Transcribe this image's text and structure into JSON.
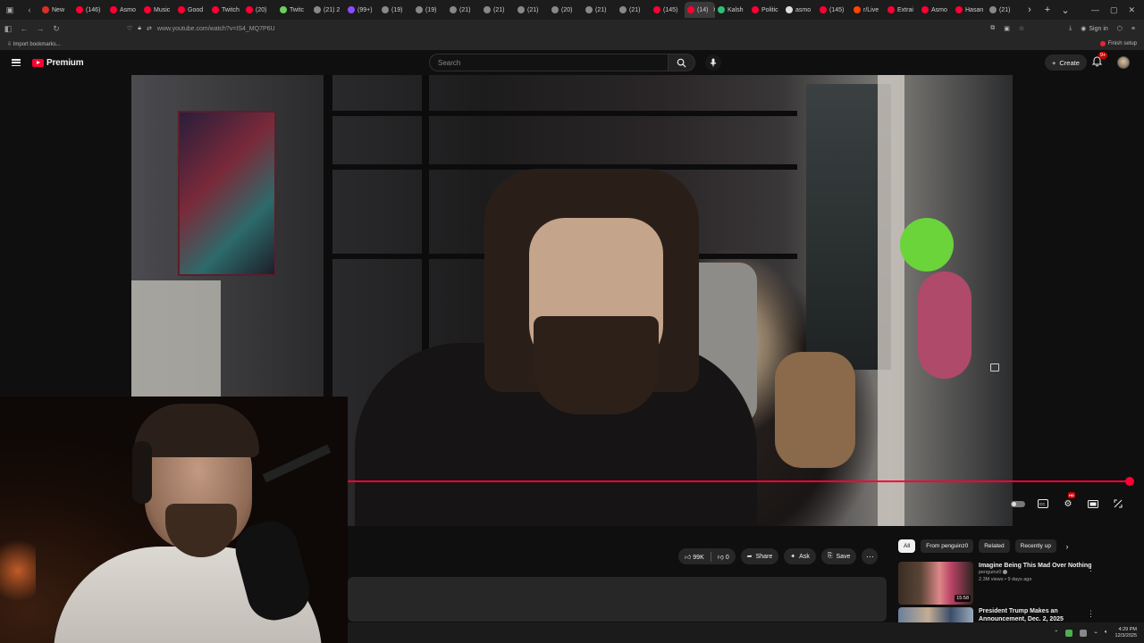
{
  "browser": {
    "tabs": [
      {
        "label": "New",
        "color": "#d93025"
      },
      {
        "label": "(146)",
        "color": "#ff0033"
      },
      {
        "label": "Asmo",
        "color": "#ff0033"
      },
      {
        "label": "Music",
        "color": "#ff0033"
      },
      {
        "label": "Good",
        "color": "#ff0033"
      },
      {
        "label": "Twitch",
        "color": "#ff0033"
      },
      {
        "label": "(20)",
        "color": "#ff0033"
      },
      {
        "label": "Twitc",
        "color": "#6ccf5a"
      },
      {
        "label": "(21) 2",
        "color": "#888888"
      },
      {
        "label": "(99+)",
        "color": "#8a4cff"
      },
      {
        "label": "(19)",
        "color": "#888888"
      },
      {
        "label": "(19)",
        "color": "#888888"
      },
      {
        "label": "(21)",
        "color": "#888888"
      },
      {
        "label": "(21)",
        "color": "#888888"
      },
      {
        "label": "(21)",
        "color": "#888888"
      },
      {
        "label": "(20)",
        "color": "#888888"
      },
      {
        "label": "(21)",
        "color": "#888888"
      },
      {
        "label": "(21)",
        "color": "#888888"
      },
      {
        "label": "(145)",
        "color": "#ff0033"
      },
      {
        "label": "(14)",
        "color": "#ff0033",
        "active": true
      },
      {
        "label": "Kalsh",
        "color": "#2fbf71"
      },
      {
        "label": "Politic",
        "color": "#ff0033"
      },
      {
        "label": "asmo",
        "color": "#dddddd"
      },
      {
        "label": "(145)",
        "color": "#ff0033"
      },
      {
        "label": "r/Live",
        "color": "#ff4500"
      },
      {
        "label": "Extrai",
        "color": "#ff0033"
      },
      {
        "label": "Asmo",
        "color": "#ff0033"
      },
      {
        "label": "Hasan",
        "color": "#ff0033"
      },
      {
        "label": "(21)",
        "color": "#888888"
      }
    ],
    "url": "www.youtube.com/watch?v=IS4_MQ7P6U",
    "signin": "Sign in",
    "bookmarks_label": "Import bookmarks...",
    "finish_setup": "Finish setup"
  },
  "youtube": {
    "logo_text": "Premium",
    "search_placeholder": "Search",
    "create_label": "Create",
    "notification_count": "9+"
  },
  "player": {
    "progress": 0.99,
    "hd_badge": "HD"
  },
  "actions": {
    "likes": "99K",
    "dislikes": "0",
    "share": "Share",
    "ask": "Ask",
    "save": "Save"
  },
  "chips": [
    {
      "label": "All",
      "active": true
    },
    {
      "label": "From penguinz0"
    },
    {
      "label": "Related"
    },
    {
      "label": "Recently up"
    }
  ],
  "recommendations": [
    {
      "title": "Imagine Being This Mad Over Nothing",
      "channel": "penguinz0",
      "stats": "2.3M views • 9 days ago",
      "duration": "15:58"
    },
    {
      "title": "President Trump Makes an Announcement, Dec. 2, 2025",
      "channel": "",
      "stats": "",
      "duration": ""
    }
  ],
  "taskbar": {
    "time": "4:29 PM",
    "date": "12/3/2025"
  }
}
